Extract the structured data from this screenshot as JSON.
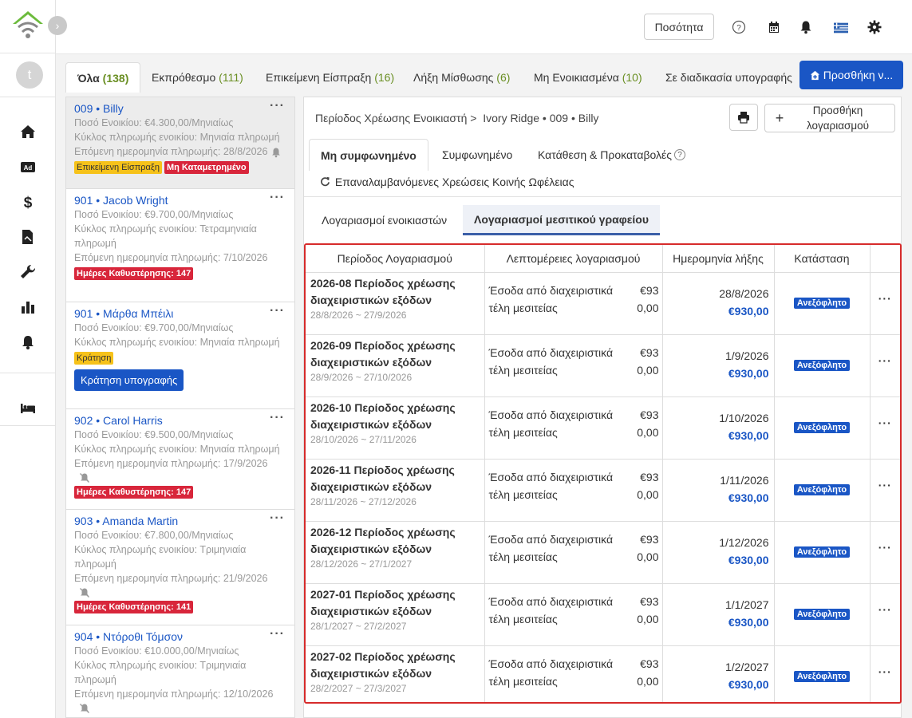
{
  "topbar": {
    "quantity_label": "Ποσότητα"
  },
  "nav": {
    "avatar_letter": "t"
  },
  "tabs": [
    {
      "label": "Όλα",
      "count": "(138)"
    },
    {
      "label": "Εκπρόθεσμο",
      "count": "(111)"
    },
    {
      "label": "Επικείμενη Είσπραξη",
      "count": "(16)"
    },
    {
      "label": "Λήξη Μίσθωσης",
      "count": "(6)"
    },
    {
      "label": "Μη Ενοικιασμένα",
      "count": "(10)"
    },
    {
      "label": "Σε διαδικασία υπογραφής",
      "count": ""
    }
  ],
  "add_property_label": "Προσθήκη ν...",
  "tenants": [
    {
      "unit": "009",
      "name": "Billy",
      "lines": [
        "Ποσό Ενοικίου: €4.300,00/Μηνιαίως",
        "Κύκλος πληρωμής ενοικίου: Μηνιαία πληρωμή",
        "Επόμενη ημερομηνία πληρωμής:  28/8/2026"
      ],
      "badges": [
        "Επικείμενη Είσπραξη",
        "Μη Καταμετρημένο"
      ]
    },
    {
      "unit": "901",
      "name": "Jacob Wright",
      "lines": [
        "Ποσό Ενοικίου: €9.700,00/Μηνιαίως",
        "Κύκλος πληρωμής ενοικίου: Τετραμηνιαία πληρωμή",
        "Επόμενη ημερομηνία πληρωμής:  7/10/2026"
      ],
      "badges": [
        "Ημέρες Καθυστέρησης: 147"
      ]
    },
    {
      "unit": "901",
      "name": "Μάρθα Μπέιλι",
      "lines": [
        "Ποσό Ενοικίου: €9.700,00/Μηνιαίως",
        "Κύκλος πληρωμής ενοικίου: Μηνιαία πληρωμή"
      ],
      "badges": [
        "Κράτηση"
      ],
      "button": "Κράτηση υπογραφής"
    },
    {
      "unit": "902",
      "name": "Carol Harris",
      "lines": [
        "Ποσό Ενοικίου: €9.500,00/Μηνιαίως",
        "Κύκλος πληρωμής ενοικίου: Μηνιαία πληρωμή",
        "Επόμενη ημερομηνία πληρωμής:  17/9/2026"
      ],
      "badges": [
        "Ημέρες Καθυστέρησης: 147"
      ]
    },
    {
      "unit": "903",
      "name": "Amanda Martin",
      "lines": [
        "Ποσό Ενοικίου: €7.800,00/Μηνιαίως",
        "Κύκλος πληρωμής ενοικίου: Τριμηνιαία πληρωμή",
        "Επόμενη ημερομηνία πληρωμής:  21/9/2026"
      ],
      "badges": [
        "Ημέρες Καθυστέρησης: 141"
      ]
    },
    {
      "unit": "904",
      "name": "Ντόροθι Τόμσον",
      "lines": [
        "Ποσό Ενοικίου: €10.000,00/Μηνιαίως",
        "Κύκλος πληρωμής ενοικίου: Τριμηνιαία πληρωμή",
        "Επόμενη ημερομηνία πληρωμής:  12/10/2026"
      ],
      "badges": []
    }
  ],
  "panel": {
    "breadcrumb_1": "Περίοδος Χρέωσης Ενοικιαστή",
    "breadcrumb_2": "Ivory Ridge • 009 • Billy",
    "add_account_label": "Προσθήκη λογαριασμού",
    "sub_tabs": [
      "Μη συμφωνημένο",
      "Συμφωνημένο",
      "Κατάθεση & Προκαταβολές"
    ],
    "recurring_label": "Επαναλαμβανόμενες Χρεώσεις Κοινής Ωφέλειας",
    "account_tabs": [
      "Λογαριασμοί ενοικιαστών",
      "Λογαριασμοί μεσιτικού γραφείου"
    ]
  },
  "table": {
    "headers": [
      "Περίοδος Λογαριασμού",
      "Λεπτομέρειες λογαριασμού",
      "Ημερομηνία λήξης",
      "Κατάσταση"
    ],
    "rows": [
      {
        "title": "2026-08 Περίοδος χρέωσης διαχειριστικών εξόδων",
        "range": "28/8/2026 ~ 27/9/2026",
        "detail": "Έσοδα από διαχειριστικά τέλη μεσιτείας",
        "amt1": "€93",
        "amt2": "0,00",
        "due": "28/8/2026",
        "total": "€930,00",
        "status": "Ανεξόφλητο"
      },
      {
        "title": "2026-09 Περίοδος χρέωσης διαχειριστικών εξόδων",
        "range": "28/9/2026 ~ 27/10/2026",
        "detail": "Έσοδα από διαχειριστικά τέλη μεσιτείας",
        "amt1": "€93",
        "amt2": "0,00",
        "due": "1/9/2026",
        "total": "€930,00",
        "status": "Ανεξόφλητο"
      },
      {
        "title": "2026-10 Περίοδος χρέωσης διαχειριστικών εξόδων",
        "range": "28/10/2026 ~ 27/11/2026",
        "detail": "Έσοδα από διαχειριστικά τέλη μεσιτείας",
        "amt1": "€93",
        "amt2": "0,00",
        "due": "1/10/2026",
        "total": "€930,00",
        "status": "Ανεξόφλητο"
      },
      {
        "title": "2026-11 Περίοδος χρέωσης διαχειριστικών εξόδων",
        "range": "28/11/2026 ~ 27/12/2026",
        "detail": "Έσοδα από διαχειριστικά τέλη μεσιτείας",
        "amt1": "€93",
        "amt2": "0,00",
        "due": "1/11/2026",
        "total": "€930,00",
        "status": "Ανεξόφλητο"
      },
      {
        "title": "2026-12 Περίοδος χρέωσης διαχειριστικών εξόδων",
        "range": "28/12/2026 ~ 27/1/2027",
        "detail": "Έσοδα από διαχειριστικά τέλη μεσιτείας",
        "amt1": "€93",
        "amt2": "0,00",
        "due": "1/12/2026",
        "total": "€930,00",
        "status": "Ανεξόφλητο"
      },
      {
        "title": "2027-01 Περίοδος χρέωσης διαχειριστικών εξόδων",
        "range": "28/1/2027 ~ 27/2/2027",
        "detail": "Έσοδα από διαχειριστικά τέλη μεσιτείας",
        "amt1": "€93",
        "amt2": "0,00",
        "due": "1/1/2027",
        "total": "€930,00",
        "status": "Ανεξόφλητο"
      },
      {
        "title": "2027-02 Περίοδος χρέωσης διαχειριστικών εξόδων",
        "range": "28/2/2027 ~ 27/3/2027",
        "detail": "Έσοδα από διαχειριστικά τέλη μεσιτείας",
        "amt1": "€93",
        "amt2": "0,00",
        "due": "1/2/2027",
        "total": "€930,00",
        "status": "Ανεξόφλητο"
      }
    ]
  },
  "colors": {
    "brand_blue": "#1a56c5",
    "logo_green": "#6cbb3c",
    "alert_red": "#d8263b",
    "warn_yellow": "#f6c21a",
    "count_green": "#6a8f23"
  },
  "icons": [
    "home-icon",
    "ad-icon",
    "dollar-icon",
    "contract-icon",
    "wrench-icon",
    "chart-icon",
    "bell-icon",
    "bed-icon",
    "help-icon",
    "calendar-icon",
    "flag-icon",
    "gear-icon",
    "print-icon",
    "refresh-icon",
    "mute-bell-icon"
  ]
}
